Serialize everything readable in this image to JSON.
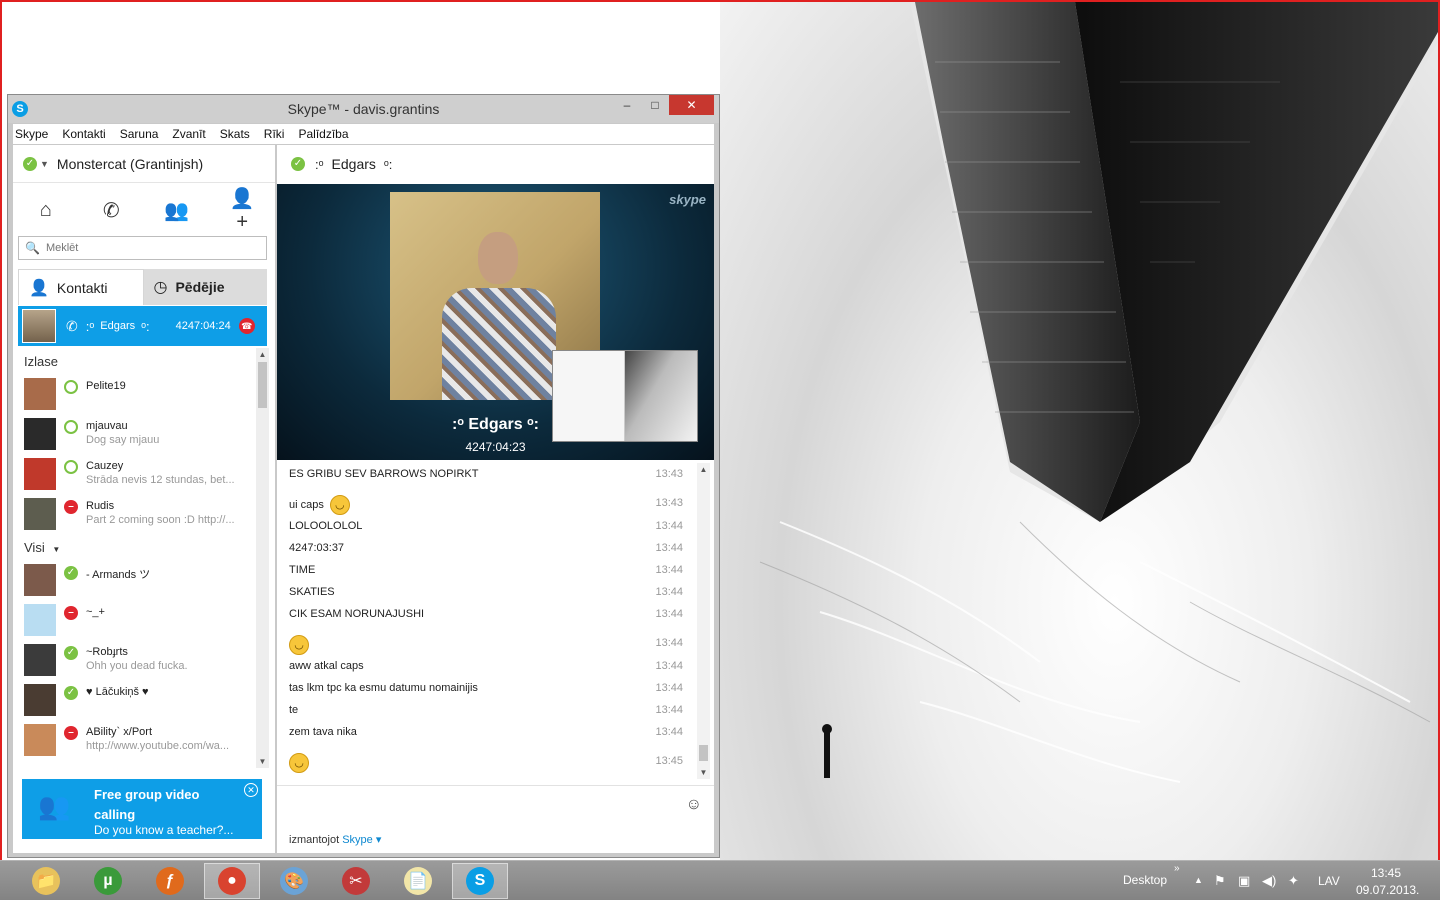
{
  "window": {
    "title": "Skype™ - davis.grantins",
    "app_icon": "S",
    "minimize": "–",
    "maximize": "□",
    "close": "✕"
  },
  "menu": [
    "Skype",
    "Kontakti",
    "Saruna",
    "Zvanīt",
    "Skats",
    "Rīki",
    "Palīdzība"
  ],
  "profile": {
    "name": "Monstercat (Grantinjsh)",
    "status": "online"
  },
  "actions": [
    {
      "icon": "home-icon",
      "glyph": "⌂"
    },
    {
      "icon": "phone-icon",
      "glyph": "✆"
    },
    {
      "icon": "group-icon",
      "glyph": "👥"
    },
    {
      "icon": "add-contact-icon",
      "glyph": "👤+"
    }
  ],
  "search": {
    "placeholder": "Meklēt"
  },
  "tabs": {
    "contacts": "Kontakti",
    "recent": "Pēdējie"
  },
  "active_call": {
    "name": "Edgars",
    "duration": "4247:04:24"
  },
  "sections": {
    "favorites": "Izlase",
    "all": "Visi"
  },
  "favorites": [
    {
      "name": "Pelite19",
      "mood": "",
      "status": "away",
      "avatar": "#a86b4a"
    },
    {
      "name": "mjauvau",
      "mood": "Dog say mjauu",
      "status": "away",
      "avatar": "#2a2a2a"
    },
    {
      "name": "Cauzey",
      "mood": "Strāda nevis 12 stundas, bet...",
      "status": "away",
      "avatar": "#c0392b"
    },
    {
      "name": "Rudis",
      "mood": "Part 2 coming soon :D http://...",
      "status": "busy",
      "avatar": "#5d5d4f"
    }
  ],
  "all_contacts": [
    {
      "name": "- Armands ツ",
      "mood": "",
      "status": "online",
      "avatar": "#7c5a4b"
    },
    {
      "name": "~_+",
      "mood": "",
      "status": "busy",
      "avatar": "#b9ddf2"
    },
    {
      "name": "~Robɟrts",
      "mood": "Ohh you dead fucka.",
      "status": "online",
      "avatar": "#3b3b3b"
    },
    {
      "name": "♥ Lāčukiņš ♥",
      "mood": "",
      "status": "online",
      "avatar": "#4a3c32"
    },
    {
      "name": "ABility` x/Port",
      "mood": "http://www.youtube.com/wa...",
      "status": "busy",
      "avatar": "#c98a5a"
    }
  ],
  "promo": {
    "title": "Free group video calling",
    "subtitle": "Do you know a teacher?...",
    "close": "✕"
  },
  "conversation": {
    "name": "Edgars",
    "watermark": "skype",
    "video_name": "Edgars",
    "video_time": "4247:04:23",
    "messages": [
      {
        "text": "ES GRIBU SEV BARROWS NOPIRKT",
        "time": "13:43",
        "smiley": false
      },
      {
        "text": "ui caps",
        "time": "13:43",
        "smiley": true
      },
      {
        "text": "LOLOOLOLOL",
        "time": "13:44",
        "smiley": false
      },
      {
        "text": "4247:03:37",
        "time": "13:44",
        "smiley": false
      },
      {
        "text": "TIME",
        "time": "13:44",
        "smiley": false
      },
      {
        "text": "SKATIES",
        "time": "13:44",
        "smiley": false
      },
      {
        "text": "CIK ESAM NORUNAJUSHI",
        "time": "13:44",
        "smiley": false
      },
      {
        "text": "",
        "time": "13:44",
        "smiley": true
      },
      {
        "text": "aww atkal caps",
        "time": "13:44",
        "smiley": false
      },
      {
        "text": "tas lkm tpc ka esmu datumu nomainijis",
        "time": "13:44",
        "smiley": false
      },
      {
        "text": "te",
        "time": "13:44",
        "smiley": false
      },
      {
        "text": "zem tava nika",
        "time": "13:44",
        "smiley": false
      },
      {
        "text": "",
        "time": "13:45",
        "smiley": true
      }
    ],
    "via_prefix": "izmantojot",
    "via_link": "Skype ▾"
  },
  "taskbar": {
    "apps": [
      {
        "id": "explorer",
        "glyph": "📁",
        "color": "#e8c25c",
        "active": false
      },
      {
        "id": "utorrent",
        "glyph": "µ",
        "color": "#3a9a3a",
        "active": false
      },
      {
        "id": "firefox",
        "glyph": "ƒ",
        "color": "#e06a1c",
        "active": false
      },
      {
        "id": "chrome",
        "glyph": "●",
        "color": "#d9432f",
        "active": true
      },
      {
        "id": "paint",
        "glyph": "🎨",
        "color": "#6ba3d6",
        "active": false
      },
      {
        "id": "snip",
        "glyph": "✂",
        "color": "#c23a3a",
        "active": false
      },
      {
        "id": "notepad",
        "glyph": "📄",
        "color": "#f2e6a8",
        "active": false
      },
      {
        "id": "skype",
        "glyph": "S",
        "color": "#0a9ee5",
        "active": true
      }
    ],
    "desktop_label": "Desktop",
    "language": "LAV",
    "time": "13:45",
    "date": "09.07.2013."
  }
}
